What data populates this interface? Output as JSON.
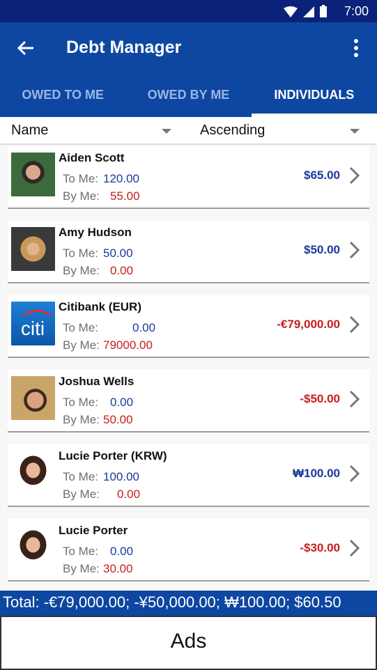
{
  "status_bar": {
    "time": "7:00",
    "icons": [
      "wifi-icon",
      "signal-icon",
      "battery-icon"
    ]
  },
  "app_bar": {
    "title": "Debt Manager",
    "back_icon": "arrow-left-icon",
    "menu_icon": "more-vert-icon"
  },
  "tabs": [
    {
      "label": "OWED TO ME",
      "active": false
    },
    {
      "label": "OWED BY ME",
      "active": false
    },
    {
      "label": "INDIVIDUALS",
      "active": true
    }
  ],
  "sort": {
    "field": "Name",
    "order": "Ascending"
  },
  "labels": {
    "to_me": "To Me:",
    "by_me": "By Me:"
  },
  "rows": [
    {
      "name": "Aiden Scott",
      "to_me": "120.00",
      "by_me": "55.00",
      "balance": "$65.00",
      "balance_type": "positive",
      "avatar": "photo-man-beard"
    },
    {
      "name": "Amy Hudson",
      "to_me": "50.00",
      "by_me": "0.00",
      "balance": "$50.00",
      "balance_type": "positive",
      "avatar": "photo-woman-flower"
    },
    {
      "name": "Citibank (EUR)",
      "to_me": "0.00",
      "by_me": "79000.00",
      "balance": "-€79,000.00",
      "balance_type": "negative",
      "avatar": "citi-logo"
    },
    {
      "name": "Joshua Wells",
      "to_me": "0.00",
      "by_me": "50.00",
      "balance": "-$50.00",
      "balance_type": "negative",
      "avatar": "photo-man-phone"
    },
    {
      "name": "Lucie Porter (KRW)",
      "to_me": "100.00",
      "by_me": "0.00",
      "balance": "₩100.00",
      "balance_type": "positive",
      "avatar": "photo-woman-smiling"
    },
    {
      "name": "Lucie Porter",
      "to_me": "0.00",
      "by_me": "30.00",
      "balance": "-$30.00",
      "balance_type": "negative",
      "avatar": "photo-woman-smiling"
    }
  ],
  "total": "Total: -€79,000.00; -¥50,000.00; ₩100.00; $60.50",
  "ads": "Ads",
  "colors": {
    "primary": "#0d47a1",
    "status": "#0a2378",
    "positive": "#1a3a9a",
    "negative": "#c81d1d"
  }
}
